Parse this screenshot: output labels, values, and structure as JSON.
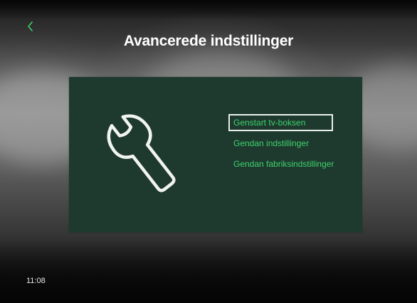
{
  "header": {
    "back_icon": "chevron-left-icon",
    "title": "Avancerede indstillinger"
  },
  "panel": {
    "icon": "wrench-icon",
    "menu": [
      {
        "label": "Genstart tv-boksen",
        "selected": true
      },
      {
        "label": "Gendan indstillinger",
        "selected": false
      },
      {
        "label": "Gendan fabriksindstillinger",
        "selected": false
      }
    ]
  },
  "status": {
    "clock": "11:08"
  },
  "colors": {
    "accent_green": "#3ed16a",
    "panel_background": "#1e3a2f",
    "selection_border": "#e9efe9"
  }
}
